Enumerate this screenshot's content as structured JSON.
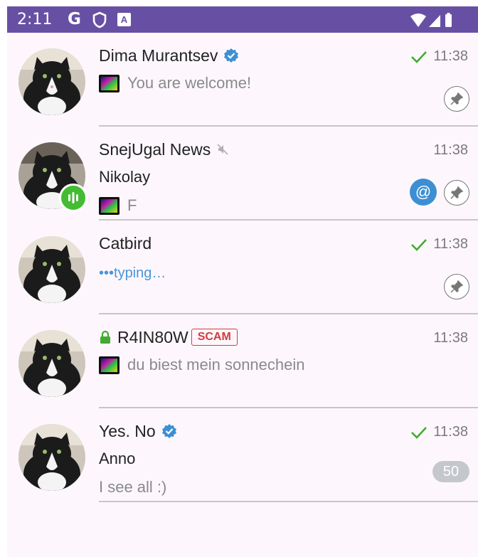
{
  "status_bar": {
    "time": "2:11",
    "g_label": "G",
    "a_label": "A",
    "icons": [
      "google-icon",
      "shield-icon",
      "accessibility-a-icon",
      "wifi-icon",
      "signal-icon",
      "battery-icon"
    ]
  },
  "colors": {
    "status_bar": "#6750a4",
    "list_bg": "#fdf7fd",
    "verified": "#3d8fd4",
    "check": "#44aa33",
    "typing": "#4a95d8",
    "scam": "#d33b3b",
    "mention": "#3d8fd4",
    "voice_chat": "#44bb33",
    "unread_badge": "#c4c8cc"
  },
  "chats": [
    {
      "name": "Dima Murantsev",
      "verified": true,
      "time": "11:38",
      "read_check": true,
      "preview": "You are welcome!",
      "preview_has_thumb": true,
      "pinned": true
    },
    {
      "name": "SnejUgal News",
      "muted": true,
      "time": "11:38",
      "sender": "Nikolay",
      "preview": "F",
      "preview_has_thumb": true,
      "mention_label": "@",
      "pinned": true,
      "voice_chat_active": true
    },
    {
      "name": "Catbird",
      "time": "11:38",
      "read_check": true,
      "typing_text": "•••typing…",
      "pinned": true
    },
    {
      "name": "R4IN80W",
      "secret_chat": true,
      "scam_label": "SCAM",
      "time": "11:38",
      "preview": "du biest mein sonnechein",
      "preview_has_thumb": true
    },
    {
      "name": "Yes. No",
      "verified": true,
      "time": "11:38",
      "read_check": true,
      "sender": "Anno",
      "preview": "I see all :)",
      "unread_count": "50"
    }
  ]
}
